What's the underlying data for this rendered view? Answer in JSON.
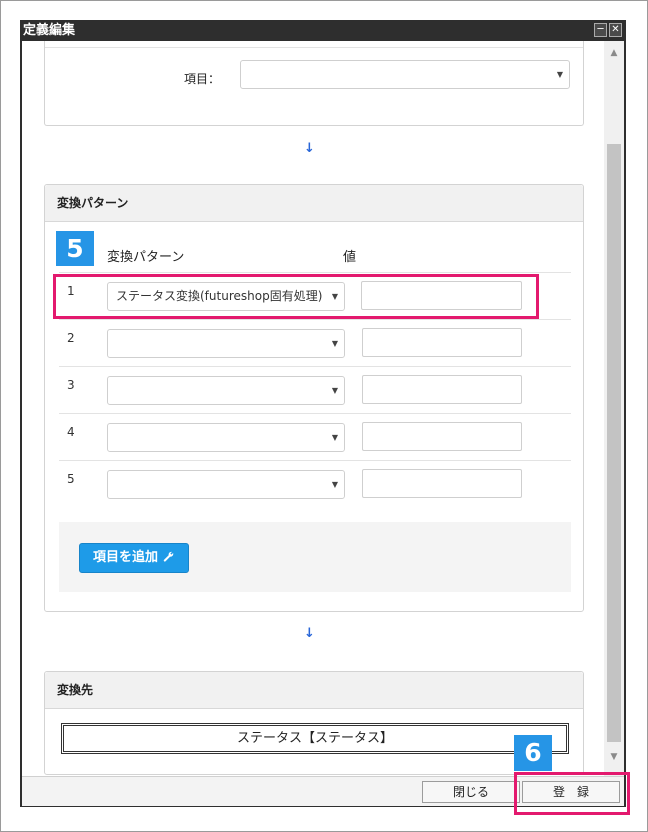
{
  "window": {
    "title": "定義編集",
    "minimize_glyph": "─",
    "close_glyph": "✕"
  },
  "item_section": {
    "label": "項目：",
    "select_value": ""
  },
  "arrow_glyph": "↓",
  "conversion_panel": {
    "header": "変換パターン",
    "column_pattern": "変換パターン",
    "column_value": "値",
    "rows": [
      {
        "num": "1",
        "pattern": "ステータス変換(futureshop固有処理)",
        "value": ""
      },
      {
        "num": "2",
        "pattern": "",
        "value": ""
      },
      {
        "num": "3",
        "pattern": "",
        "value": ""
      },
      {
        "num": "4",
        "pattern": "",
        "value": ""
      },
      {
        "num": "5",
        "pattern": "",
        "value": ""
      }
    ],
    "add_button": "項目を追加",
    "add_icon": "wrench-icon"
  },
  "destination_panel": {
    "header": "変換先",
    "value": "ステータス【ステータス】"
  },
  "footer": {
    "close_button": "閉じる",
    "register_button": "登　録"
  },
  "annotations": {
    "badge_5": "5",
    "badge_6": "6"
  },
  "colors": {
    "accent": "#1e9be8",
    "highlight": "#e3196e",
    "badge": "#2695e6",
    "titlebar": "#2e2e2e"
  }
}
